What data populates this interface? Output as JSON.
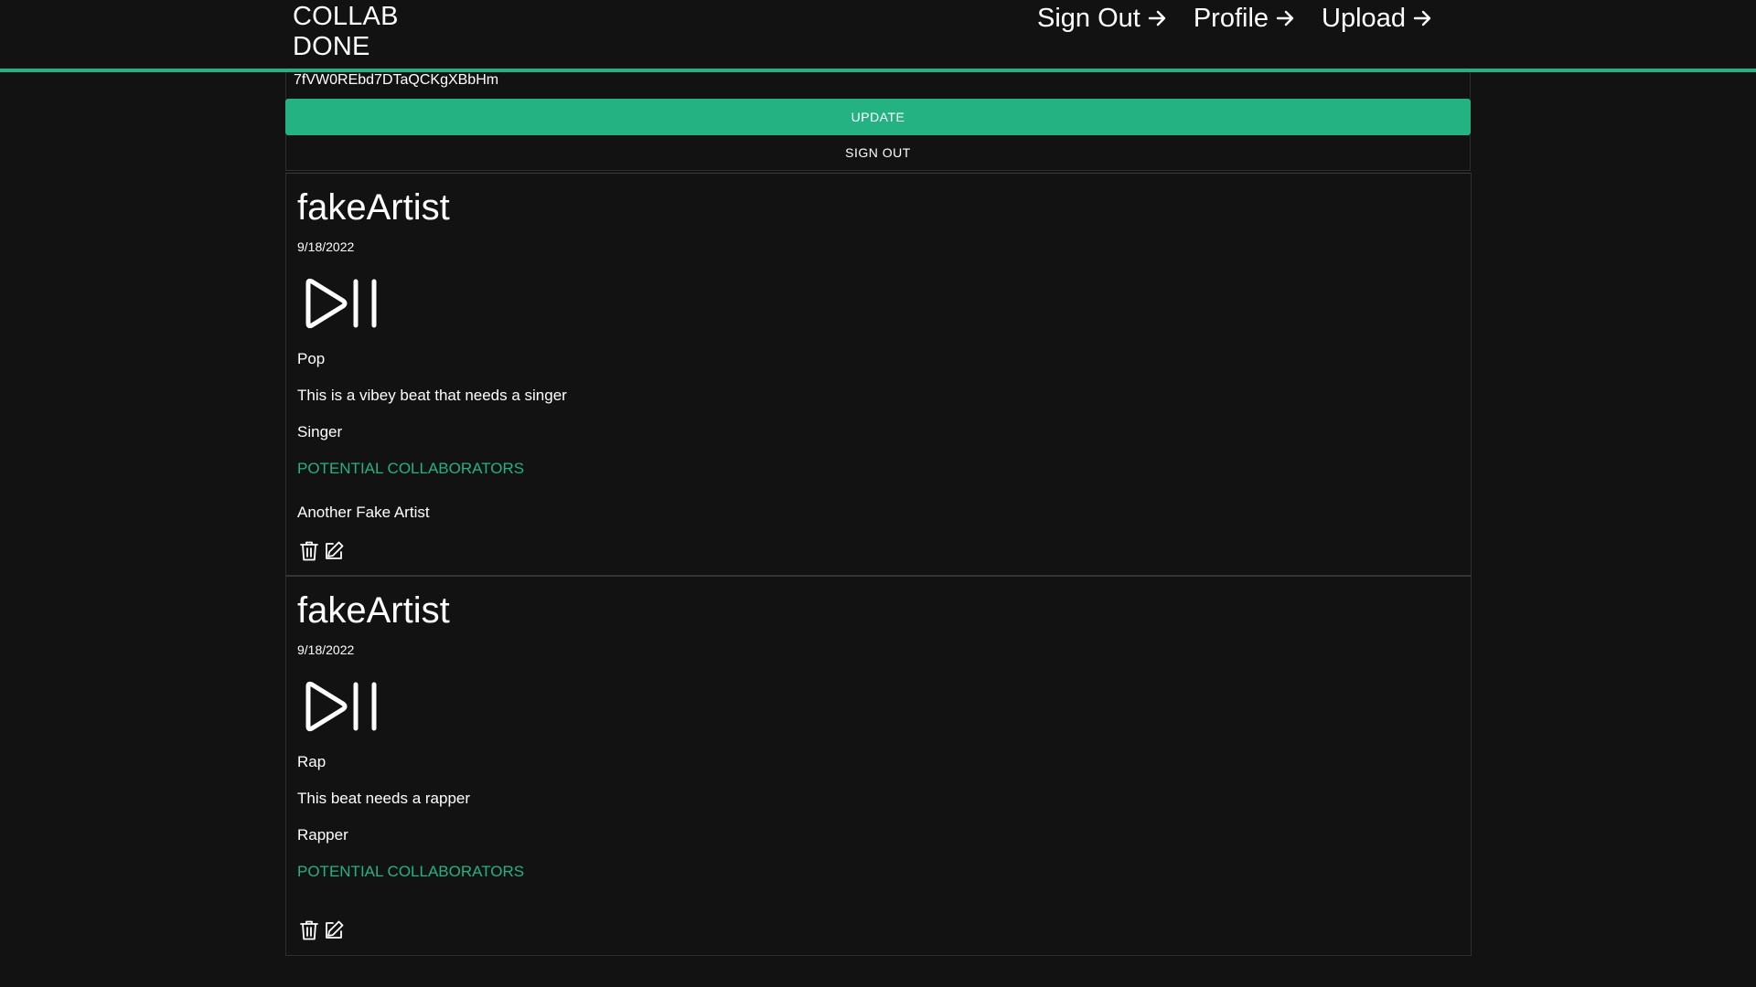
{
  "header": {
    "brand_line1": "COLLAB",
    "brand_line2": "DONE",
    "nav": [
      {
        "label": "Sign Out"
      },
      {
        "label": "Profile"
      },
      {
        "label": "Upload"
      }
    ]
  },
  "profile": {
    "user_id": "7fVW0REbd7DTaQCKgXBbHm",
    "update_label": "UPDATE",
    "signout_label": "SIGN OUT"
  },
  "posts": [
    {
      "artist": "fakeArtist",
      "date": "9/18/2022",
      "genre": "Pop",
      "description": "This is a vibey beat that needs a singer",
      "looking_for": "Singer",
      "collab_link": "POTENTIAL COLLABORATORS",
      "collaborator": "Another Fake Artist"
    },
    {
      "artist": "fakeArtist",
      "date": "9/18/2022",
      "genre": "Rap",
      "description": "This beat needs a rapper",
      "looking_for": "Rapper",
      "collab_link": "POTENTIAL COLLABORATORS"
    }
  ],
  "icons": {
    "play_pause": "play-pause-icon",
    "delete": "trash-icon",
    "edit": "edit-icon",
    "arrow": "arrow-right-icon"
  },
  "colors": {
    "accent": "#25b283",
    "background": "#121212",
    "border": "#2e2e2e"
  }
}
